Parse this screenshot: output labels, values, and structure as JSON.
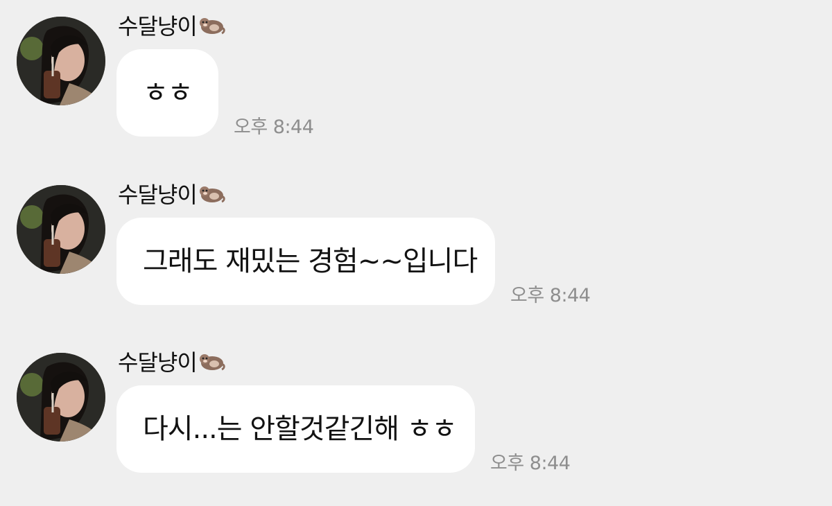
{
  "messages": [
    {
      "sender": "수달냥이",
      "sender_icon": "otter-emoji-icon",
      "text": "ㅎㅎ",
      "time": "오후 8:44"
    },
    {
      "sender": "수달냥이",
      "sender_icon": "otter-emoji-icon",
      "text": "그래도 재밌는 경험~~입니다",
      "time": "오후 8:44"
    },
    {
      "sender": "수달냥이",
      "sender_icon": "otter-emoji-icon",
      "text": "다시...는 안할것같긴해 ㅎㅎ",
      "time": "오후 8:44"
    }
  ],
  "colors": {
    "background": "#efefef",
    "bubble": "#ffffff",
    "text": "#121212",
    "time": "#8e8e8e"
  }
}
